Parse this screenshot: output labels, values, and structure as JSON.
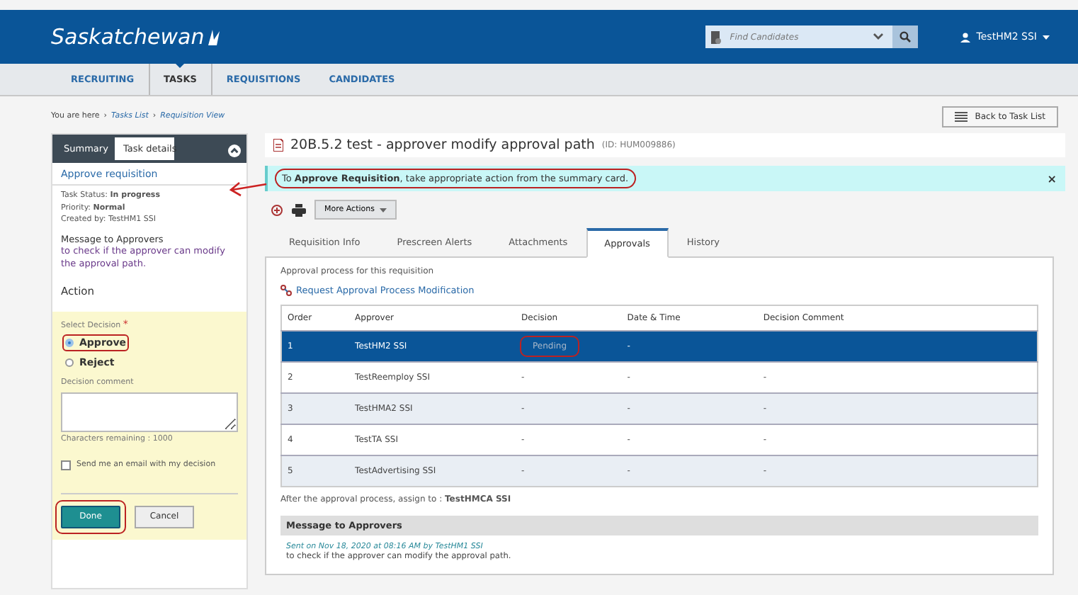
{
  "header": {
    "logo": "Saskatchewan",
    "search": {
      "placeholder": "Find Candidates"
    },
    "user": "TestHM2 SSI"
  },
  "nav": {
    "items": [
      {
        "label": "RECRUITING",
        "selected": false
      },
      {
        "label": "TASKS",
        "selected": true
      },
      {
        "label": "REQUISITIONS",
        "selected": false
      },
      {
        "label": "CANDIDATES",
        "selected": false
      }
    ]
  },
  "breadcrumb": {
    "lead": "You are here",
    "separator": "›",
    "links": [
      "Tasks List",
      "Requisition View"
    ]
  },
  "back_button": "Back to Task List",
  "side_panel": {
    "tabs": [
      {
        "label": "Summary",
        "selected": false
      },
      {
        "label": "Task details",
        "selected": true
      }
    ],
    "task_title": "Approve requisition",
    "details": [
      "Task Status: **In progress**",
      "Priority: **Normal**",
      "Created by: TestHM1 SSI"
    ],
    "message_heading": "Message to Approvers",
    "message": "to check if the approver can modify the approval path.",
    "action_heading": "Action",
    "decision_label": "Select Decision",
    "required_mark": "*",
    "options": [
      {
        "label": "Approve",
        "selected": true,
        "highlighted": true
      },
      {
        "label": "Reject",
        "selected": false,
        "highlighted": false
      }
    ],
    "comment_label": "Decision comment",
    "chars_remaining": "Characters remaining : 1000",
    "email_option": {
      "label": "Send me an email with my decision",
      "checked": false
    },
    "buttons": [
      {
        "label": "Done",
        "kind": "primary",
        "highlighted": true
      },
      {
        "label": "Cancel",
        "kind": "secondary",
        "highlighted": false
      }
    ]
  },
  "main": {
    "title": "20B.5.2 test - approver modify approval path",
    "id": "(ID: HUM009886)",
    "banner": {
      "text": "To **Approve Requisition**, take appropriate action from the summary card.",
      "highlighted": true,
      "callout_arrow": true,
      "close": "×"
    },
    "more_actions": "More Actions",
    "tabs": [
      {
        "label": "Requisition Info",
        "selected": false
      },
      {
        "label": "Prescreen Alerts",
        "selected": false
      },
      {
        "label": "Attachments",
        "selected": false
      },
      {
        "label": "Approvals",
        "selected": true
      },
      {
        "label": "History",
        "selected": false
      }
    ],
    "intro": "Approval process for this requisition",
    "modify_link": "Request Approval Process Modification",
    "table": {
      "columns": [
        "Order",
        "Approver",
        "Decision",
        "Date & Time",
        "Decision Comment"
      ],
      "rows": [
        {
          "cells": [
            "1",
            "TestHM2 SSI",
            "Pending",
            "-",
            ""
          ],
          "selected": true,
          "highlighted": true
        },
        {
          "cells": [
            "2",
            "TestReemploy SSI",
            "-",
            "-",
            "-"
          ],
          "selected": false,
          "highlighted": false
        },
        {
          "cells": [
            "3",
            "TestHMA2 SSI",
            "-",
            "-",
            "-"
          ],
          "selected": false,
          "highlighted": false
        },
        {
          "cells": [
            "4",
            "TestTA SSI",
            "-",
            "-",
            "-"
          ],
          "selected": false,
          "highlighted": false
        },
        {
          "cells": [
            "5",
            "TestAdvertising SSI",
            "-",
            "-",
            "-"
          ],
          "selected": false,
          "highlighted": false
        }
      ]
    },
    "assign": "After the approval process, assign to : **TestHMCA SSI**",
    "message_heading": "Message to Approvers",
    "message_meta": "Sent on Nov 18, 2020 at 08:16 AM by TestHM1 SSI",
    "message": "to check if the approver can modify the approval path."
  }
}
